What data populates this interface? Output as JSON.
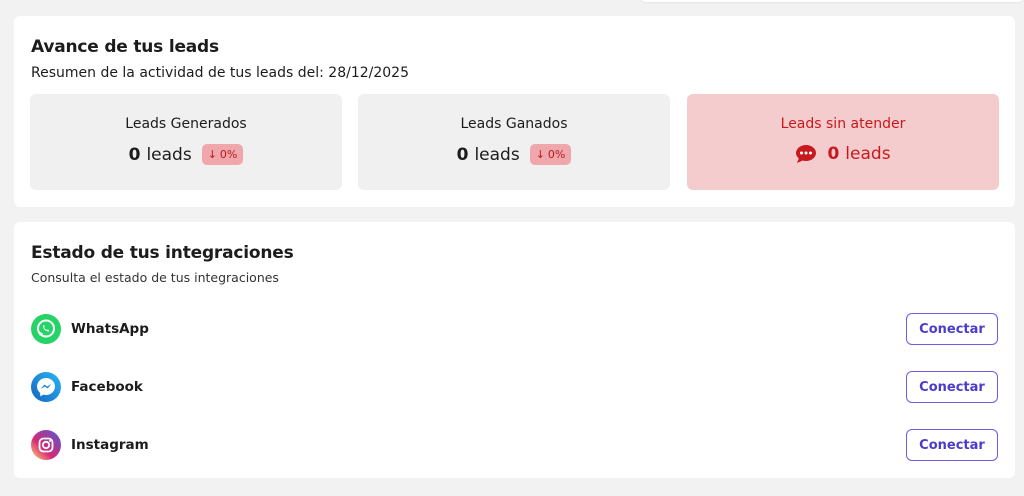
{
  "leads_card": {
    "title": "Avance de tus leads",
    "subtitle": "Resumen de la actividad de tus leads del: 28/12/2025",
    "stats": [
      {
        "label": "Leads Generados",
        "count": "0",
        "unit": "leads",
        "change": "0%",
        "change_icon": "arrow-down"
      },
      {
        "label": "Leads Ganados",
        "count": "0",
        "unit": "leads",
        "change": "0%",
        "change_icon": "arrow-down"
      },
      {
        "label": "Leads sin atender",
        "count": "0",
        "unit": "leads",
        "icon": "chat-bubble-icon"
      }
    ]
  },
  "integrations_card": {
    "title": "Estado de tus integraciones",
    "subtitle": "Consulta el estado de tus integraciones",
    "items": [
      {
        "name": "WhatsApp",
        "icon": "whatsapp-icon",
        "button_label": "Conectar"
      },
      {
        "name": "Facebook",
        "icon": "messenger-icon",
        "button_label": "Conectar"
      },
      {
        "name": "Instagram",
        "icon": "instagram-icon",
        "button_label": "Conectar"
      }
    ]
  },
  "colors": {
    "accent": "#6c5ce7",
    "alert_red": "#c8191f",
    "alert_bg": "#f4cccd",
    "whatsapp": "#25d366",
    "messenger": "#1e88e5"
  }
}
